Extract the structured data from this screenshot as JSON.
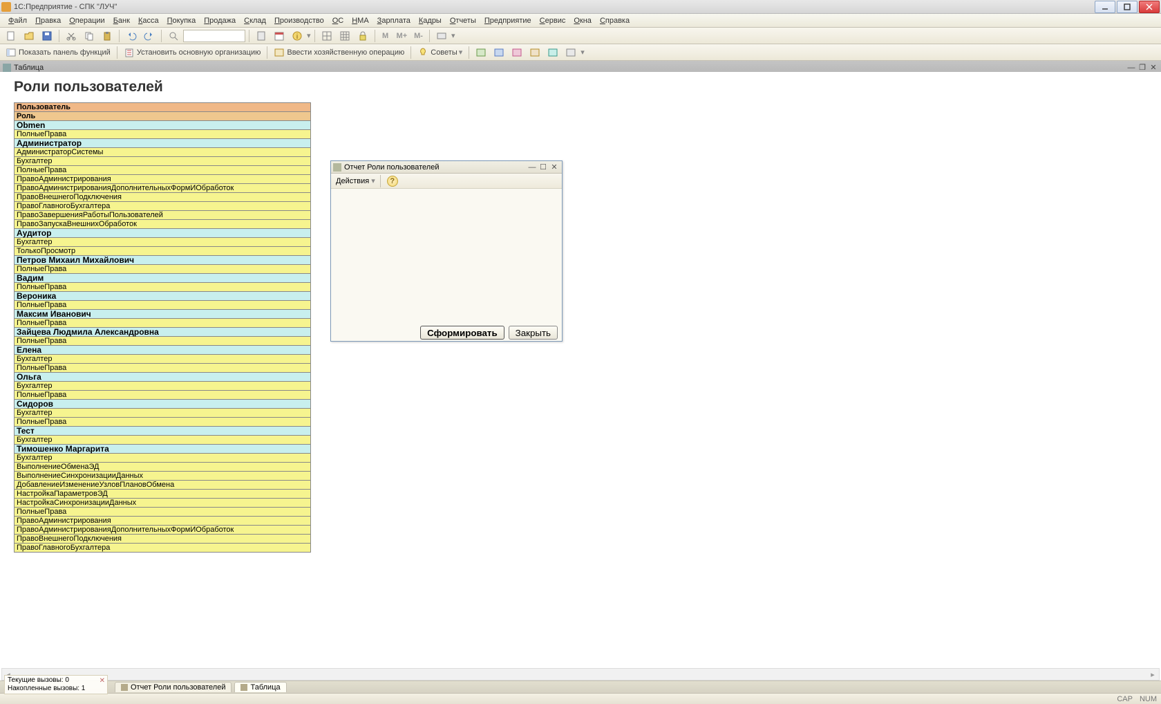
{
  "window": {
    "title": "1С:Предприятие - СПК \"ЛУЧ\"",
    "min_tooltip": "Свернуть",
    "max_tooltip": "Развернуть",
    "close_tooltip": "Закрыть"
  },
  "menu": {
    "items": [
      "Файл",
      "Правка",
      "Операции",
      "Банк",
      "Касса",
      "Покупка",
      "Продажа",
      "Склад",
      "Производство",
      "ОС",
      "НМА",
      "Зарплата",
      "Кадры",
      "Отчеты",
      "Предприятие",
      "Сервис",
      "Окна",
      "Справка"
    ]
  },
  "toolbar2": {
    "show_panel": "Показать панель функций",
    "set_org": "Установить основную организацию",
    "enter_op": "Ввести хозяйственную операцию",
    "tips": "Советы"
  },
  "doctab": {
    "label": "Таблица"
  },
  "page": {
    "title": "Роли пользователей"
  },
  "table": {
    "header_user": "Пользователь",
    "header_role": "Роль",
    "groups": [
      {
        "user": "Obmen",
        "roles": [
          "ПолныеПрава"
        ]
      },
      {
        "user": "Администратор",
        "roles": [
          "АдминистраторСистемы",
          "Бухгалтер",
          "ПолныеПрава",
          "ПравоАдминистрирования",
          "ПравоАдминистрированияДополнительныхФормИОбработок",
          "ПравоВнешнегоПодключения",
          "ПравоГлавногоБухгалтера",
          "ПравоЗавершенияРаботыПользователей",
          "ПравоЗапускаВнешнихОбработок"
        ]
      },
      {
        "user": "Аудитор",
        "roles": [
          "Бухгалтер",
          "ТолькоПросмотр"
        ]
      },
      {
        "user": "Петров Михаил Михайлович",
        "roles": [
          "ПолныеПрава"
        ]
      },
      {
        "user": "Вадим",
        "roles": [
          "ПолныеПрава"
        ]
      },
      {
        "user": "Вероника",
        "roles": [
          "ПолныеПрава"
        ]
      },
      {
        "user": "Максим Иванович",
        "roles": [
          "ПолныеПрава"
        ]
      },
      {
        "user": "Зайцева Людмила Александровна",
        "roles": [
          "ПолныеПрава"
        ]
      },
      {
        "user": "Елена",
        "roles": [
          "Бухгалтер",
          "ПолныеПрава"
        ]
      },
      {
        "user": "Ольга",
        "roles": [
          "Бухгалтер",
          "ПолныеПрава"
        ]
      },
      {
        "user": "Сидоров",
        "roles": [
          "Бухгалтер",
          "ПолныеПрава"
        ]
      },
      {
        "user": "Тест",
        "roles": [
          "Бухгалтер"
        ]
      },
      {
        "user": "Тимошенко Маргарита",
        "roles": [
          "Бухгалтер",
          "ВыполнениеОбменаЭД",
          "ВыполнениеСинхронизацииДанных",
          "ДобавлениеИзменениеУзловПлановОбмена",
          "НастройкаПараметровЭД",
          "НастройкаСинхронизацииДанных",
          "ПолныеПрава",
          "ПравоАдминистрирования",
          "ПравоАдминистрированияДополнительныхФормИОбработок",
          "ПравоВнешнегоПодключения",
          "ПравоГлавногоБухгалтера"
        ]
      }
    ]
  },
  "modal": {
    "title": "Отчет  Роли пользователей",
    "actions": "Действия",
    "generate": "Сформировать",
    "close": "Закрыть"
  },
  "bottomtabs": {
    "t1": "Отчет  Роли пользователей",
    "t2": "Таблица"
  },
  "calls": {
    "l1": "Текущие вызовы: 0",
    "l2": "Накопленные вызовы: 1"
  },
  "status": {
    "cap": "CAP",
    "num": "NUM"
  }
}
